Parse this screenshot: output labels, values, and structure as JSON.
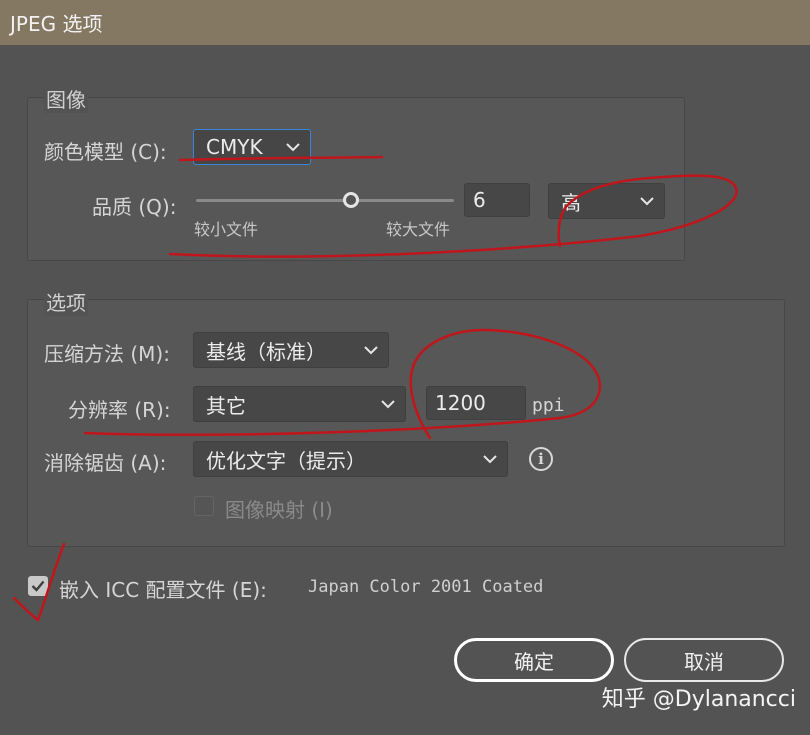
{
  "window": {
    "title": "JPEG 选项"
  },
  "image_group": {
    "title": "图像",
    "color_model": {
      "label": "颜色模型 (C):",
      "value": "CMYK"
    },
    "quality": {
      "label": "品质 (Q):",
      "slider_value": 6,
      "slider_range": [
        0,
        10
      ],
      "min_label": "较小文件",
      "max_label": "较大文件",
      "value": "6",
      "preset": "高"
    }
  },
  "options_group": {
    "title": "选项",
    "compression": {
      "label": "压缩方法 (M):",
      "value": "基线（标准）"
    },
    "resolution": {
      "label": "分辨率 (R):",
      "value": "其它",
      "custom_value": "1200",
      "unit": "ppi"
    },
    "antialias": {
      "label": "消除锯齿 (A):",
      "value": "优化文字（提示）"
    },
    "imagemap": {
      "label": "图像映射 (I)",
      "checked": false
    }
  },
  "embed_icc": {
    "label": "嵌入 ICC 配置文件 (E):",
    "profile": "Japan Color 2001 Coated",
    "checked": true
  },
  "buttons": {
    "ok": "确定",
    "cancel": "取消"
  },
  "watermark": "知乎 @Dylanancci",
  "colors": {
    "titlebar": "#857862",
    "background": "#535353",
    "focus": "#3a86d9",
    "annotation": "#c0161b"
  }
}
